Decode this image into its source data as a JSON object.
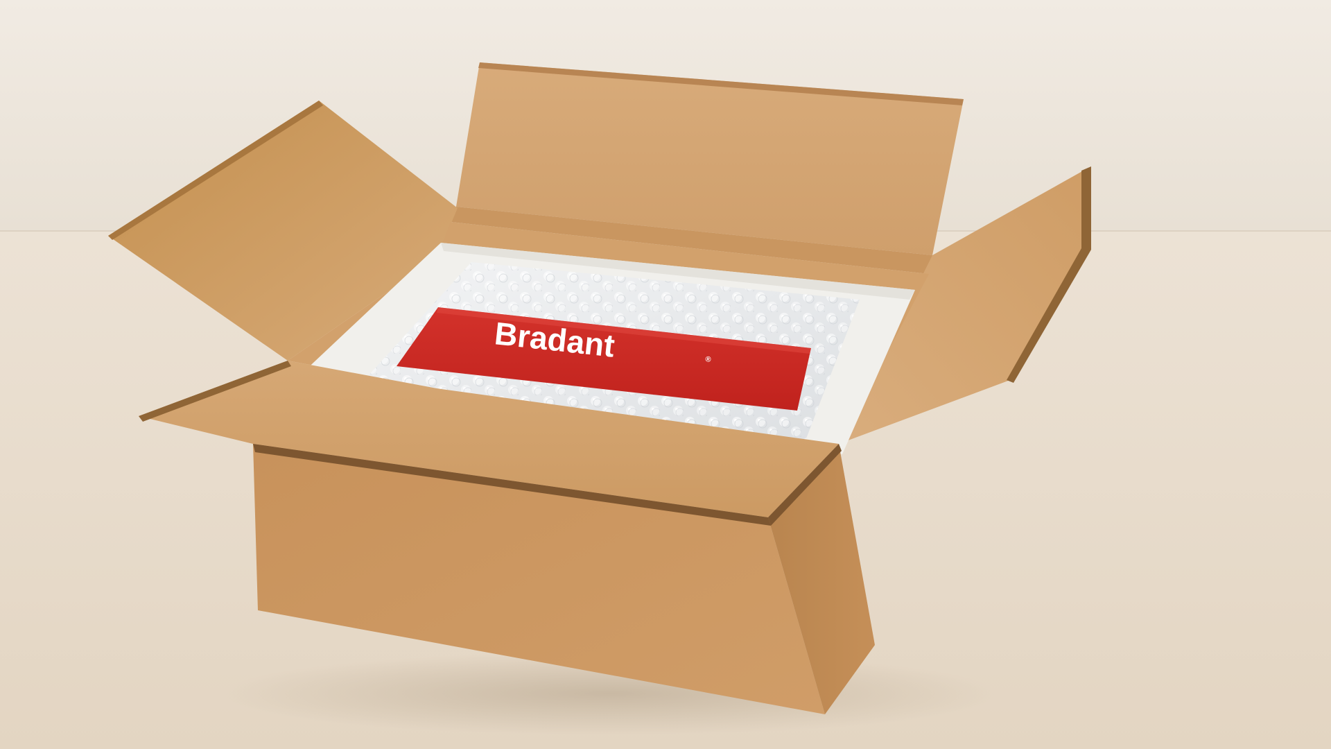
{
  "scene": {
    "subject": "open-cardboard-box",
    "colors": {
      "wall": "#eae3d8",
      "floor": "#e9dcca",
      "cardboard_front": "#c9955f",
      "cardboard_inside": "#d4a674",
      "cardboard_flap_outer": "#b58552",
      "foam": "#f2f1ee",
      "bubble_wrap": "#e6e9ec",
      "label_red": "#cc2a24"
    }
  },
  "label": {
    "brand": "Bradant",
    "registered_mark": "®"
  }
}
